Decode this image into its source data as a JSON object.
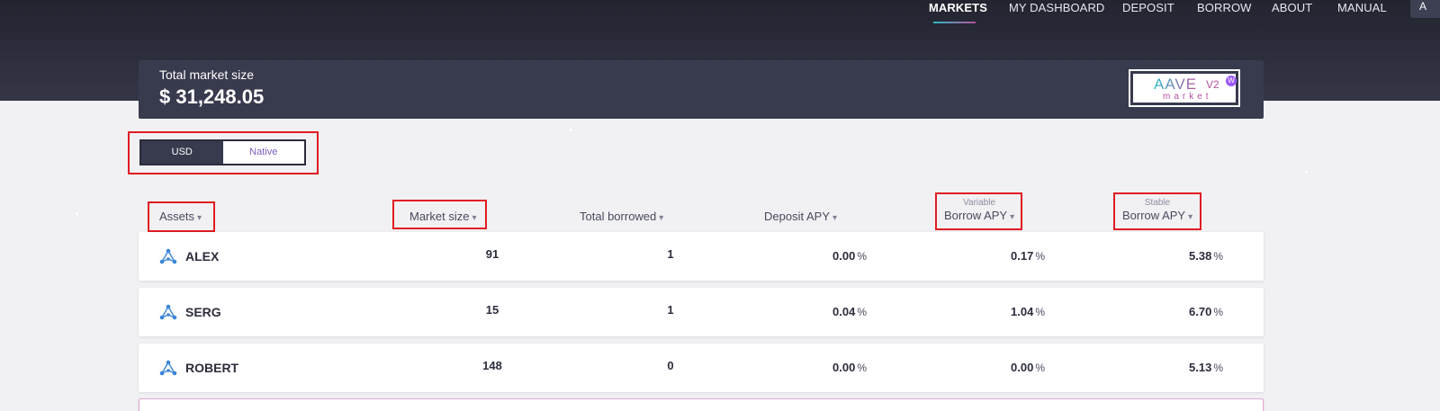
{
  "nav": {
    "items": [
      "MARKETS",
      "MY DASHBOARD",
      "DEPOSIT",
      "BORROW",
      "ABOUT",
      "MANUAL"
    ],
    "corner_glyph": "A"
  },
  "market": {
    "title": "Total market size",
    "value": "$ 31,248.05",
    "badge": {
      "logo": "AAVE",
      "version": "V2",
      "sub": "market",
      "network_mark": "W"
    }
  },
  "currency_toggle": {
    "options": [
      "USD",
      "Native"
    ],
    "selected": "Native"
  },
  "table": {
    "headers": {
      "assets": "Assets",
      "market_size": "Market size",
      "total_borrowed": "Total borrowed",
      "deposit_apy": "Deposit APY",
      "variable_sub": "Variable",
      "variable_main": "Borrow APY",
      "stable_sub": "Stable",
      "stable_main": "Borrow APY"
    },
    "sort_arrow": "▾",
    "percent_unit": "%",
    "rows": [
      {
        "asset": "ALEX",
        "market_size": "91",
        "total_borrowed": "1",
        "deposit_apy": "0.00",
        "variable_apy": "0.17",
        "stable_apy": "5.38"
      },
      {
        "asset": "SERG",
        "market_size": "15",
        "total_borrowed": "1",
        "deposit_apy": "0.04",
        "variable_apy": "1.04",
        "stable_apy": "6.70"
      },
      {
        "asset": "ROBERT",
        "market_size": "148",
        "total_borrowed": "0",
        "deposit_apy": "0.00",
        "variable_apy": "0.00",
        "stable_apy": "5.13"
      }
    ]
  },
  "colors": {
    "hero": "#2a2c3b",
    "highlight": "#e11b22",
    "accent_start": "#2ebac6",
    "accent_end": "#b6509e"
  }
}
